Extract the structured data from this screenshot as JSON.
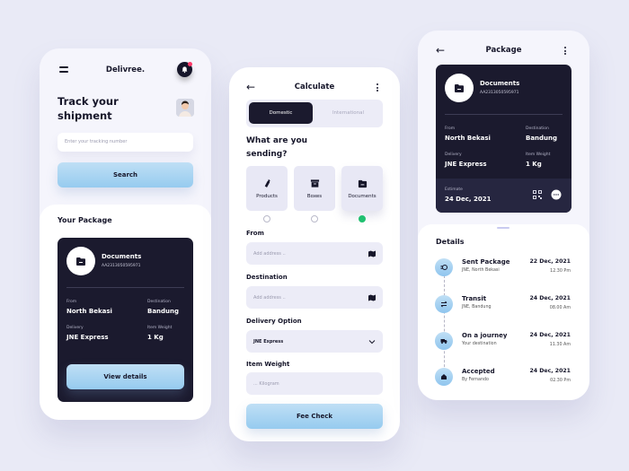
{
  "home": {
    "brand": "Delivree.",
    "title": "Track your shipment",
    "tracking_placeholder": "Enter your tracking number",
    "search_label": "Search",
    "package_section_title": "Your Package",
    "package": {
      "type": "Documents",
      "tracking_id": "AA2313050595971",
      "from_label": "From",
      "from": "North Bekasi",
      "destination_label": "Destination",
      "destination": "Bandung",
      "delivery_label": "Delivery",
      "delivery": "JNE Express",
      "weight_label": "Item Weight",
      "weight": "1 Kg"
    },
    "view_details_label": "View details"
  },
  "calculate": {
    "title": "Calculate",
    "tabs": [
      {
        "label": "Domestic",
        "active": true
      },
      {
        "label": "International",
        "active": false
      }
    ],
    "question": "What are you sending?",
    "categories": [
      {
        "label": "Products",
        "icon": "bottle-icon",
        "selected": false
      },
      {
        "label": "Boxes",
        "icon": "box-icon",
        "selected": false
      },
      {
        "label": "Documents",
        "icon": "folder-icon",
        "selected": true
      }
    ],
    "from_label": "From",
    "from_placeholder": "Add address ..",
    "destination_label": "Destination",
    "destination_placeholder": "Add address ..",
    "delivery_label": "Delivery Option",
    "delivery_value": "JNE Express",
    "weight_label": "Item Weight",
    "weight_placeholder": "... Kilogram",
    "fee_check_label": "Fee Check"
  },
  "package_screen": {
    "title": "Package",
    "package": {
      "type": "Documents",
      "tracking_id": "AA2313050595971",
      "from_label": "From",
      "from": "North Bekasi",
      "destination_label": "Destination",
      "destination": "Bandung",
      "delivery_label": "Delivery",
      "delivery": "JNE Express",
      "weight_label": "Item Weight",
      "weight": "1 Kg",
      "estimate_label": "Estimate",
      "estimate": "24 Dec, 2021"
    },
    "details_title": "Details",
    "timeline": [
      {
        "title": "Sent Package",
        "sub": "JNE, North Bekasi",
        "date": "22 Dec, 2021",
        "time": "12.30 Pm",
        "icon": "package-send-icon"
      },
      {
        "title": "Transit",
        "sub": "JNE, Bandung",
        "date": "24 Dec, 2021",
        "time": "08.00 Am",
        "icon": "transfer-icon"
      },
      {
        "title": "On a journey",
        "sub": "Your destination",
        "date": "24 Dec, 2021",
        "time": "11.30 Am",
        "icon": "truck-icon"
      },
      {
        "title": "Accepted",
        "sub": "By Fernando",
        "date": "24 Dec, 2021",
        "time": "02.30 Pm",
        "icon": "home-icon"
      }
    ]
  },
  "colors": {
    "accent": "#96cbef",
    "dark": "#1b1a2e",
    "success": "#20c070",
    "notification": "#ff3a6a"
  }
}
